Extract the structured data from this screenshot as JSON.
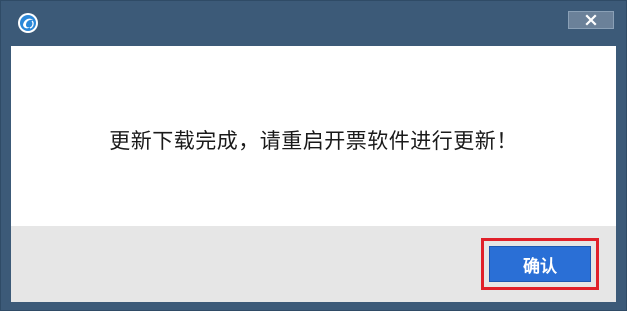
{
  "window": {
    "title_icon": "app-logo-icon",
    "close_icon": "close-icon",
    "close_label": "×"
  },
  "dialog": {
    "message": "更新下载完成，请重启开票软件进行更新！"
  },
  "footer": {
    "confirm_label": "确认"
  },
  "colors": {
    "titlebar": "#3c5a78",
    "content_bg": "#ffffff",
    "footer_bg": "#e6e6e6",
    "button_bg": "#2a6fd6",
    "highlight": "#e0202a"
  }
}
